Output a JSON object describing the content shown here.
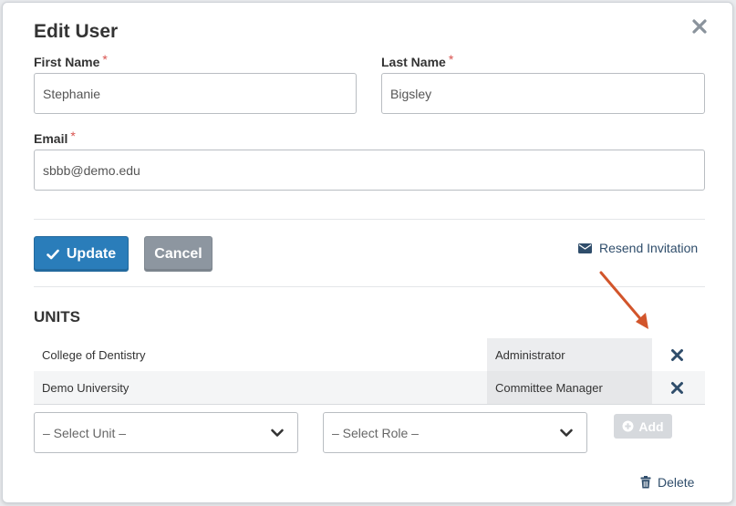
{
  "dialog": {
    "title": "Edit User",
    "required_mark": "*"
  },
  "form": {
    "first_name": {
      "label": "First Name",
      "value": "Stephanie"
    },
    "last_name": {
      "label": "Last Name",
      "value": "Bigsley"
    },
    "email": {
      "label": "Email",
      "value": "sbbb@demo.edu"
    }
  },
  "actions": {
    "update_label": "Update",
    "cancel_label": "Cancel",
    "resend_label": "Resend Invitation"
  },
  "units": {
    "title": "UNITS",
    "rows": [
      {
        "unit": "College of Dentistry",
        "role": "Administrator"
      },
      {
        "unit": "Demo University",
        "role": "Committee Manager"
      }
    ],
    "select_unit_placeholder": "– Select Unit –",
    "select_role_placeholder": "– Select Role –",
    "add_label": "Add"
  },
  "footer": {
    "delete_label": "Delete"
  },
  "colors": {
    "primary": "#2a7dba",
    "cancel": "#8d96a0",
    "link": "#2f4d6b",
    "required": "#d9534f",
    "annotation_arrow": "#d2552b"
  },
  "icons": {
    "close": "close-icon",
    "check": "check-icon",
    "envelope": "envelope-icon",
    "remove": "remove-icon",
    "chevron": "chevron-down-icon",
    "plus": "plus-circle-icon",
    "trash": "trash-icon"
  }
}
